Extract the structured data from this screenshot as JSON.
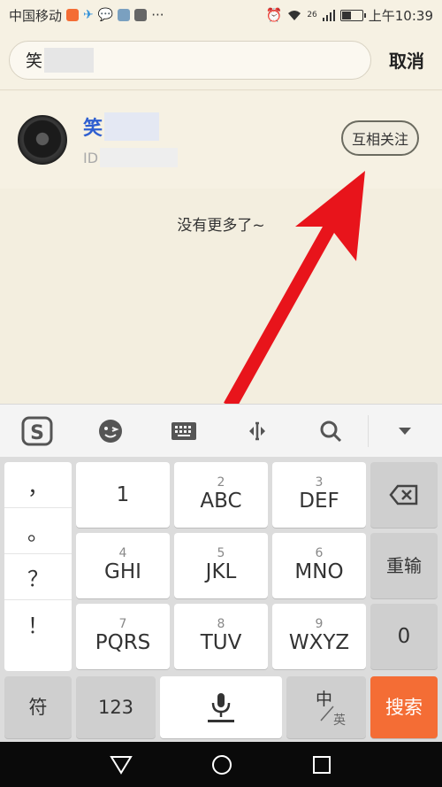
{
  "status_bar": {
    "carrier": "中国移动",
    "ellipsis": "···",
    "network": "26",
    "time": "上午10:39",
    "battery_level": 0.45
  },
  "search": {
    "query_prefix": "笑",
    "cancel_label": "取消"
  },
  "result": {
    "name_visible": "笑",
    "id_prefix": "ID",
    "follow_label": "互相关注"
  },
  "empty_hint": "没有更多了~",
  "annotation": {
    "arrow_color": "#e8141b"
  },
  "keyboard": {
    "punctuation": [
      "，",
      "。",
      "？",
      "！"
    ],
    "keys": [
      {
        "num": "",
        "label": "1"
      },
      {
        "num": "2",
        "label": "ABC"
      },
      {
        "num": "3",
        "label": "DEF"
      },
      {
        "num": "4",
        "label": "GHI"
      },
      {
        "num": "5",
        "label": "JKL"
      },
      {
        "num": "6",
        "label": "MNO"
      },
      {
        "num": "7",
        "label": "PQRS"
      },
      {
        "num": "8",
        "label": "TUV"
      },
      {
        "num": "9",
        "label": "WXYZ"
      }
    ],
    "reenter_label": "重输",
    "zero_label": "0",
    "symbol_label": "符",
    "num_label": "123",
    "zh_label": "中",
    "en_label": "英",
    "search_label": "搜索",
    "search_color": "#f46d35"
  }
}
